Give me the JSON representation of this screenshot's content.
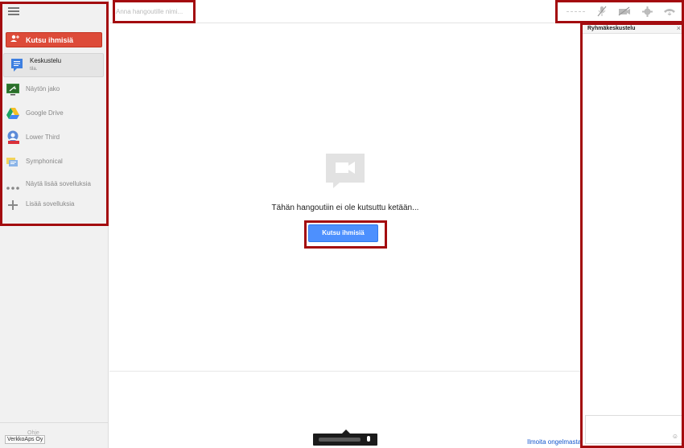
{
  "topbar": {
    "name_placeholder": "Anna hangoutille nimi..."
  },
  "sidebar": {
    "invite_label": "Kutsu ihmisiä",
    "apps": [
      {
        "label": "Keskustelu",
        "sub": "tila."
      },
      {
        "label": "Näytön jako"
      },
      {
        "label": "Google Drive"
      },
      {
        "label": "Lower Third"
      },
      {
        "label": "Symphonical"
      }
    ],
    "more_apps": "Näytä lisää sovelluksia",
    "add_apps": "Lisää sovelluksia",
    "footer_badge": "VerkkoAps Oy",
    "footer_text": "Ohje"
  },
  "stage": {
    "empty_message": "Tähän hangoutiin ei ole kutsuttu ketään...",
    "invite_button": "Kutsu ihmisiä"
  },
  "chat": {
    "title": "Ryhmäkeskustelu",
    "close": "×"
  },
  "footer": {
    "report_link": "Ilmoita ongelmasta"
  },
  "icons": [
    "menu-icon",
    "add-person-icon",
    "chat-icon",
    "screenshare-icon",
    "drive-icon",
    "lower-third-icon",
    "symphonical-icon",
    "more-icon",
    "plus-icon",
    "signal-icon",
    "mic-off-icon",
    "camera-off-icon",
    "gear-icon",
    "hangup-icon",
    "camera-icon",
    "emoji-icon"
  ],
  "colors": {
    "invite_red": "#dd4b39",
    "invite_blue": "#4d90fe",
    "highlight": "#a30b0f",
    "link": "#1155cc"
  }
}
